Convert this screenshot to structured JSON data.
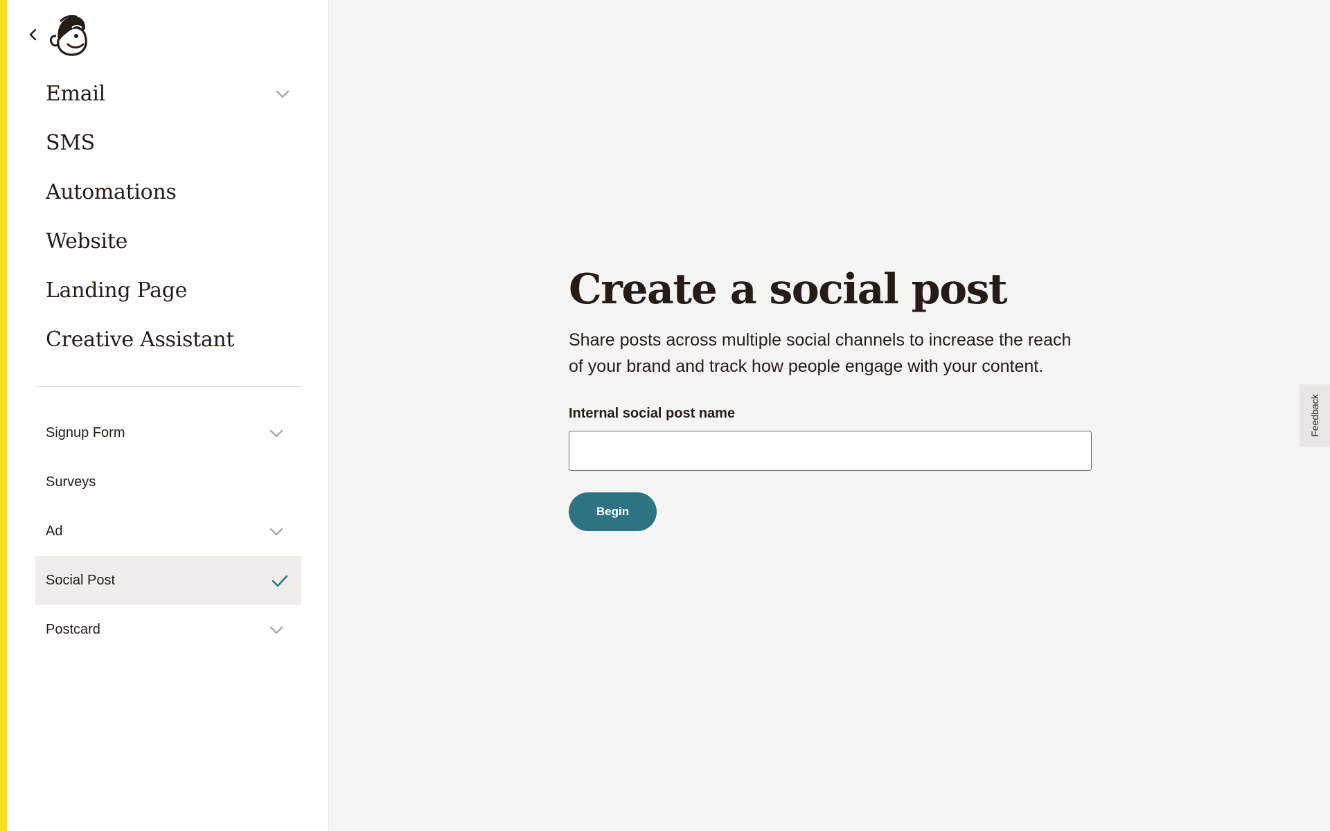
{
  "sidebar": {
    "back_icon": "chevron-left-icon",
    "logo": "mailchimp-freddie-logo",
    "primary_items": [
      {
        "label": "Email",
        "has_chevron": true
      },
      {
        "label": "SMS",
        "has_chevron": false
      },
      {
        "label": "Automations",
        "has_chevron": false
      },
      {
        "label": "Website",
        "has_chevron": false
      },
      {
        "label": "Landing Page",
        "has_chevron": false
      },
      {
        "label": "Creative Assistant",
        "has_chevron": false
      }
    ],
    "secondary_items": [
      {
        "label": "Signup Form",
        "has_chevron": true,
        "selected": false
      },
      {
        "label": "Surveys",
        "has_chevron": false,
        "selected": false
      },
      {
        "label": "Ad",
        "has_chevron": true,
        "selected": false
      },
      {
        "label": "Social Post",
        "has_chevron": false,
        "selected": true
      },
      {
        "label": "Postcard",
        "has_chevron": true,
        "selected": false
      }
    ]
  },
  "main": {
    "title": "Create a social post",
    "description": "Share posts across multiple social channels to increase the reach of your brand and track how people engage with your content.",
    "field_label": "Internal social post name",
    "field_value": "",
    "begin_label": "Begin"
  },
  "feedback": {
    "label": "Feedback"
  },
  "colors": {
    "accent_yellow": "#ffe01b",
    "button_teal": "#2e7384",
    "check_teal": "#2e7384",
    "background": "#f5f5f3",
    "selected_row": "#efeeea"
  }
}
